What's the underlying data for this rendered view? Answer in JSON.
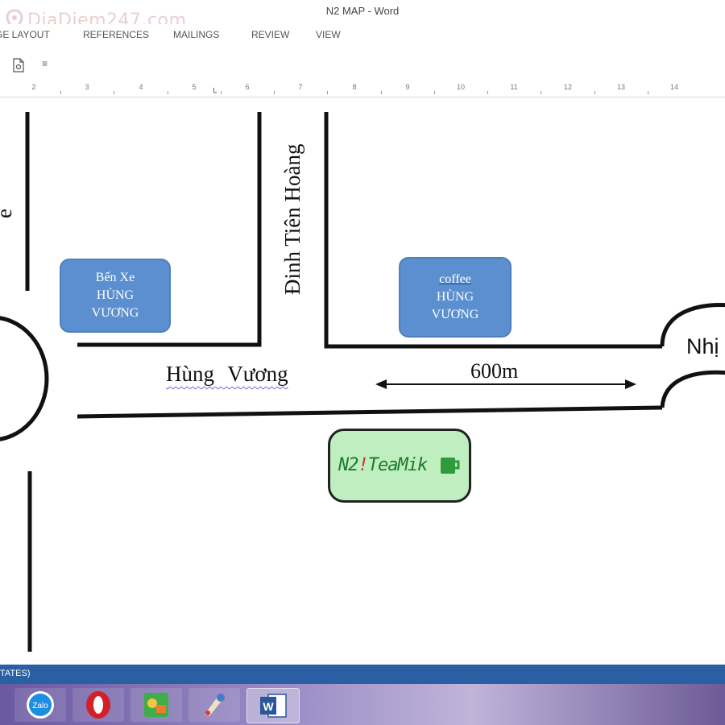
{
  "window": {
    "title": "N2 MAP - Word"
  },
  "watermark": {
    "text": "DiaDiem247.com",
    "icon": "map-pin-icon"
  },
  "ribbon": {
    "tabs": [
      {
        "label": "GE LAYOUT"
      },
      {
        "label": "REFERENCES"
      },
      {
        "label": "MAILINGS"
      },
      {
        "label": "REVIEW"
      },
      {
        "label": "VIEW"
      }
    ]
  },
  "quick_access": {
    "more": "≡"
  },
  "ruler": {
    "ticks": [
      "2",
      "3",
      "4",
      "5",
      "6",
      "7",
      "8",
      "9",
      "10",
      "11",
      "12",
      "13",
      "14"
    ]
  },
  "map": {
    "box_ben_xe": {
      "line1": "Bến Xe",
      "line2": "HÙNG",
      "line3": "VƯƠNG"
    },
    "box_coffee": {
      "line1": "coffee",
      "line2": "HÙNG",
      "line3": "VƯƠNG"
    },
    "street_hung_vuong": "Hùng  Vương",
    "street_dinh_tien_hoang": "Đinh Tiên Hoàng",
    "street_nhi": "Nhị",
    "street_left": "ễ",
    "distance": "600m",
    "logo": {
      "part1": "N2",
      "part2": "!",
      "part3": "TeaMik",
      "icon": "cup-icon"
    }
  },
  "status_bar": {
    "text": "TATES)"
  },
  "taskbar": {
    "items": [
      {
        "name": "zalo",
        "label": "Zalo"
      },
      {
        "name": "opera",
        "label": ""
      },
      {
        "name": "paint",
        "label": ""
      },
      {
        "name": "brush",
        "label": ""
      },
      {
        "name": "word",
        "label": "W"
      }
    ]
  },
  "colors": {
    "box_fill": "#5b8fcf",
    "logo_fill": "#bfeec0",
    "status_bar": "#2a5fa3"
  }
}
